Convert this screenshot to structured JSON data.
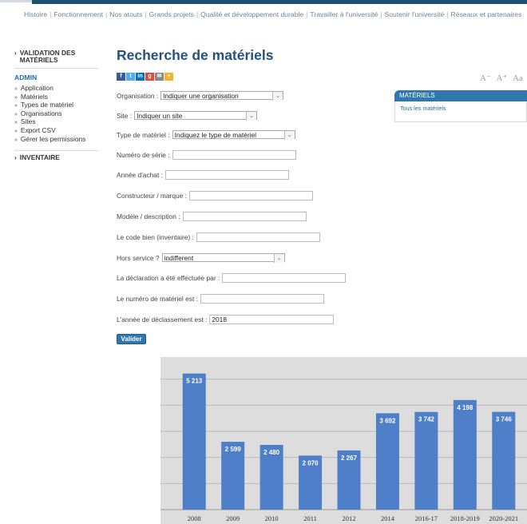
{
  "topnav": {
    "items": [
      "Histoire",
      "Fonctionnement",
      "Nos atouts",
      "Grands projets",
      "Qualité et développement durable",
      "Travailler à l'université",
      "Soutenir l'université",
      "Réseaux et partenaires"
    ],
    "separator": "|"
  },
  "sidebar": {
    "validation_label": "VALIDATION DES MATÉRIELS",
    "admin_label": "ADMIN",
    "items": [
      "Application",
      "Matériels",
      "Types de matériel",
      "Organisations",
      "Sites",
      "Export CSV",
      "Gérer les permissions"
    ],
    "inventaire_label": "INVENTAIRE"
  },
  "page": {
    "title": "Recherche de matériels"
  },
  "fontsize": {
    "smaller": "A⁻",
    "larger": "A⁺",
    "reset": "Aa"
  },
  "form": {
    "organisation_label": "Organisation :",
    "organisation_value": "Indiquer une organisation",
    "site_label": "Site :",
    "site_value": "Indiquer un site",
    "type_label": "Type de matériel :",
    "type_value": "Indiquez le type de matériel",
    "serie_label": "Numéro de série :",
    "annee_label": "Année d'achat :",
    "constructeur_label": "Constructeur / marque :",
    "modele_label": "Modèle / description :",
    "codebien_label": "Le code bien (inventaire) :",
    "hors_service_label": "Hors service ?",
    "hors_service_value": "indifferent",
    "declaration_label": "La déclaration a été effectuée par :",
    "numero_label": "Le numéro de matériel est :",
    "declassement_label": "L'année de déclassement est :",
    "declassement_value": "2018",
    "submit_label": "Valider"
  },
  "panel": {
    "title": "MATÉRIELS",
    "link": "Tous les matériels"
  },
  "colors": {
    "bar": "#4f7fc9",
    "accent": "#2f78ad",
    "title": "#23527c"
  },
  "chart_data": {
    "type": "bar",
    "categories": [
      "2008",
      "2009",
      "2010",
      "2011",
      "2012",
      "2014",
      "2016-17",
      "2018-2019",
      "2020-2021"
    ],
    "values": [
      5213,
      2599,
      2480,
      2070,
      2267,
      3692,
      3742,
      4198,
      3746
    ],
    "labels": [
      "5 213",
      "2 599",
      "2 480",
      "2 070",
      "2 267",
      "3 692",
      "3 742",
      "4 198",
      "3 746"
    ],
    "ylim": [
      0,
      5600
    ],
    "grid": true
  }
}
